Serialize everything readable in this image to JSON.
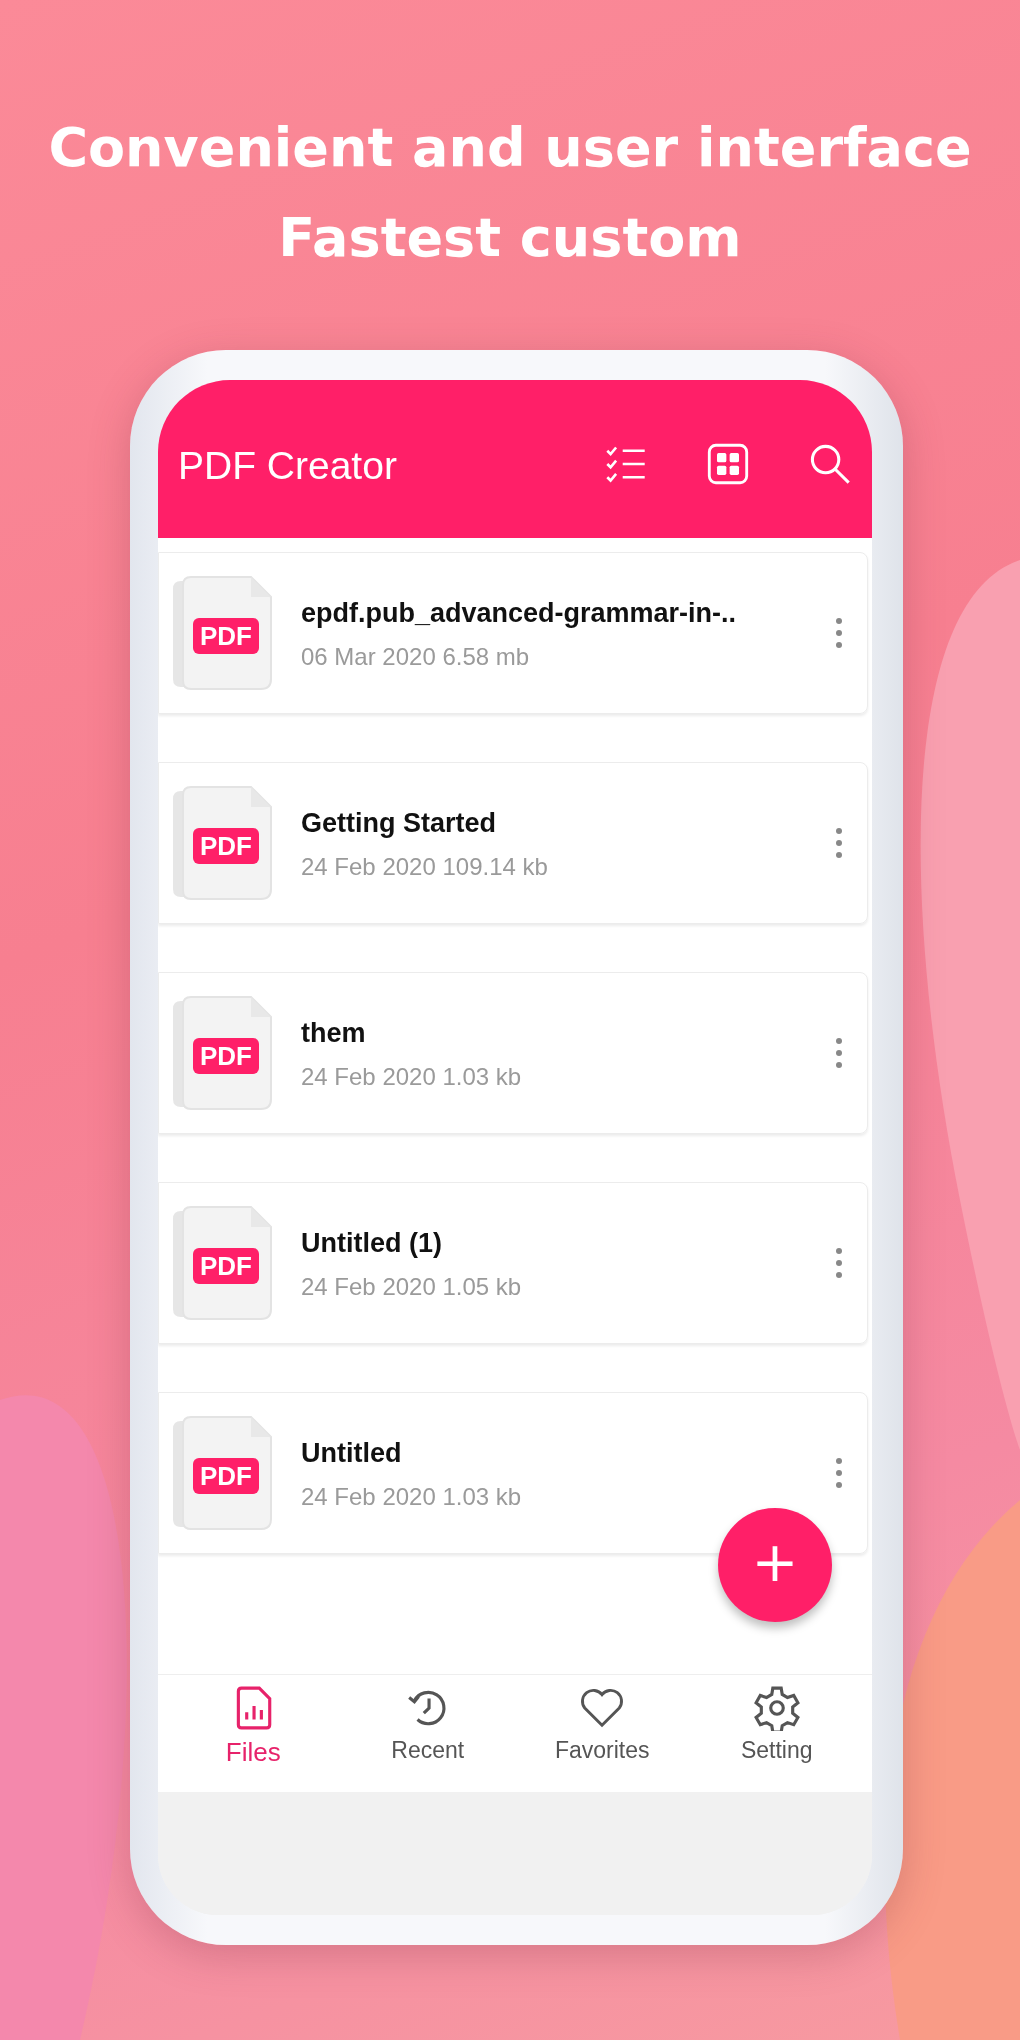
{
  "headline": [
    "Convenient and user interface",
    "Fastest custom"
  ],
  "app_bar": {
    "title": "PDF Creator"
  },
  "files": [
    {
      "name": "epdf.pub_advanced-grammar-in-..",
      "meta": "06 Mar 2020 6.58 mb",
      "badge": "PDF"
    },
    {
      "name": "Getting Started",
      "meta": "24 Feb 2020 109.14 kb",
      "badge": "PDF"
    },
    {
      "name": "them",
      "meta": "24 Feb 2020 1.03 kb",
      "badge": "PDF"
    },
    {
      "name": "Untitled (1)",
      "meta": "24 Feb 2020 1.05 kb",
      "badge": "PDF"
    },
    {
      "name": "Untitled",
      "meta": "24 Feb 2020 1.03 kb",
      "badge": "PDF"
    }
  ],
  "fab": {
    "label": "+"
  },
  "bottom_nav": [
    {
      "kind": "files",
      "label": "Files",
      "selected": true
    },
    {
      "kind": "recent",
      "label": "Recent",
      "selected": false
    },
    {
      "kind": "favorites",
      "label": "Favorites",
      "selected": false
    },
    {
      "kind": "setting",
      "label": "Setting",
      "selected": false
    }
  ]
}
